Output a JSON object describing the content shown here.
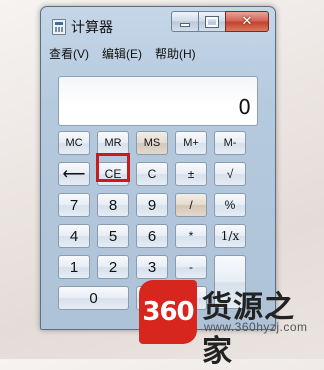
{
  "window": {
    "title": "计算器",
    "minimize": "–",
    "close": "✕"
  },
  "menubar": {
    "items": [
      "查看(V)",
      "编辑(E)",
      "帮助(H)"
    ]
  },
  "display": {
    "value": "0"
  },
  "keys": {
    "mc": "MC",
    "mr": "MR",
    "ms": "MS",
    "mplus": "M+",
    "mminus": "M-",
    "backspace": "⟵",
    "ce": "CE",
    "c": "C",
    "plusminus": "±",
    "sqrt": "√",
    "n7": "7",
    "n8": "8",
    "n9": "9",
    "divide": "/",
    "percent": "%",
    "n4": "4",
    "n5": "5",
    "n6": "6",
    "multiply": "*",
    "reciprocal": "1/x",
    "n1": "1",
    "n2": "2",
    "n3": "3",
    "minus": "-",
    "n0": "0"
  },
  "highlight": {
    "target": "C",
    "color": "#c81b1b"
  },
  "watermark": {
    "badge": "360",
    "title": "货源之家",
    "url": "www.360hyzj.com",
    "color": "#d7261e"
  }
}
